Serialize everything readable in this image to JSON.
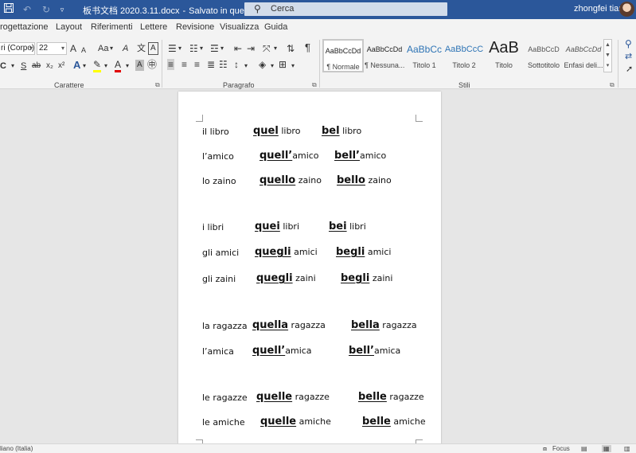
{
  "titlebar": {
    "save_icon": "save-icon",
    "document_name": "板书文档 2020.3.11.docx",
    "separator": "-",
    "save_status": "Salvato in questo PC",
    "search_placeholder": "Cerca",
    "user_name": "zhongfei tian",
    "accent_color": "#2b579a"
  },
  "menu": {
    "tabs": [
      "rogettazione",
      "Layout",
      "Riferimenti",
      "Lettere",
      "Revisione",
      "Visualizza",
      "Guida"
    ]
  },
  "ribbon": {
    "font_name": "ri (Corpo)",
    "font_size": "22",
    "grow_font": "A",
    "shrink_font": "A",
    "change_case": "Aa",
    "clear_format": "A",
    "charmap": "A",
    "bold": "C",
    "strike": "ab",
    "subscript": "x₂",
    "superscript": "x²",
    "text_effects": "A",
    "font_color": "A",
    "shading_letter": "A",
    "group_font_label": "Carattere",
    "pilcrow": "¶",
    "group_paragraph_label": "Paragrafo",
    "styles": [
      {
        "sample": "AaBbCcDd",
        "name": "¶ Normale"
      },
      {
        "sample": "AaBbCcDd",
        "name": "¶ Nessuna..."
      },
      {
        "sample": "AaBbCc",
        "name": "Titolo 1"
      },
      {
        "sample": "AaBbCcC",
        "name": "Titolo 2"
      },
      {
        "sample": "AaB",
        "name": "Titolo"
      },
      {
        "sample": "AaBbCcD",
        "name": "Sottotitolo"
      },
      {
        "sample": "AaBbCcDd",
        "name": "Enfasi deli..."
      }
    ],
    "group_styles_label": "Stili"
  },
  "document": {
    "rows": [
      {
        "c1": "il libro",
        "c2b": "quel",
        "c2": " libro",
        "c3b": "bel",
        "c3": " libro"
      },
      {
        "c1": "l’amico",
        "c2b": "quell’",
        "c2": "amico",
        "c3b": "bell’",
        "c3": "amico"
      },
      {
        "c1": "lo zaino",
        "c2b": "quello",
        "c2": " zaino",
        "c3b": "bello",
        "c3": " zaino"
      },
      {
        "c1": "i libri",
        "c2b": "quei",
        "c2": " libri",
        "c3b": "bei",
        "c3": " libri"
      },
      {
        "c1": "gli amici",
        "c2b": "quegli",
        "c2": " amici",
        "c3b": "begli",
        "c3": " amici"
      },
      {
        "c1": "gli zaini",
        "c2b": "quegli",
        "c2": " zaini",
        "c3b": "begli",
        "c3": " zaini"
      },
      {
        "c1": "la ragazza",
        "c2b": "quella",
        "c2": " ragazza",
        "c3b": "bella",
        "c3": " ragazza"
      },
      {
        "c1": "l’amica",
        "c2b": "quell’",
        "c2": "amica",
        "c3b": "bell’",
        "c3": "amica"
      },
      {
        "c1": "le ragazze",
        "c2b": "quelle",
        "c2": " ragazze",
        "c3b": "belle",
        "c3": " ragazze"
      },
      {
        "c1": "le amiche",
        "c2b": "quelle",
        "c2": " amiche",
        "c3b": "belle",
        "c3": " amiche"
      }
    ]
  },
  "statusbar": {
    "language": "liano (Italia)",
    "focus_label": "Focus"
  }
}
